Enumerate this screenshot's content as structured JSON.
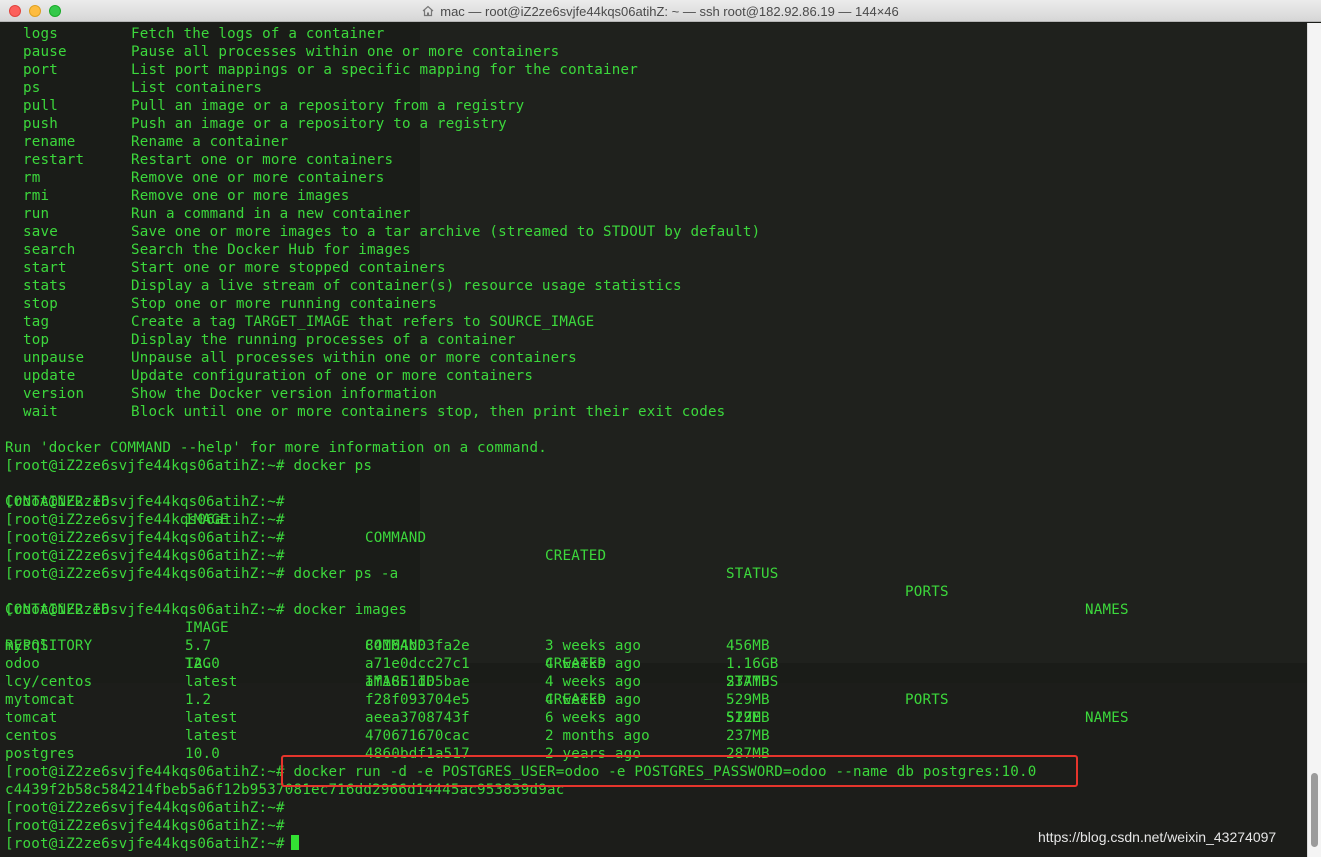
{
  "window": {
    "title": "mac — root@iZ2ze6svjfe44kqs06atihZ: ~ — ssh root@182.92.86.19 — 144×46"
  },
  "commands_help": [
    {
      "cmd": "logs",
      "desc": "Fetch the logs of a container"
    },
    {
      "cmd": "pause",
      "desc": "Pause all processes within one or more containers"
    },
    {
      "cmd": "port",
      "desc": "List port mappings or a specific mapping for the container"
    },
    {
      "cmd": "ps",
      "desc": "List containers"
    },
    {
      "cmd": "pull",
      "desc": "Pull an image or a repository from a registry"
    },
    {
      "cmd": "push",
      "desc": "Push an image or a repository to a registry"
    },
    {
      "cmd": "rename",
      "desc": "Rename a container"
    },
    {
      "cmd": "restart",
      "desc": "Restart one or more containers"
    },
    {
      "cmd": "rm",
      "desc": "Remove one or more containers"
    },
    {
      "cmd": "rmi",
      "desc": "Remove one or more images"
    },
    {
      "cmd": "run",
      "desc": "Run a command in a new container"
    },
    {
      "cmd": "save",
      "desc": "Save one or more images to a tar archive (streamed to STDOUT by default)"
    },
    {
      "cmd": "search",
      "desc": "Search the Docker Hub for images"
    },
    {
      "cmd": "start",
      "desc": "Start one or more stopped containers"
    },
    {
      "cmd": "stats",
      "desc": "Display a live stream of container(s) resource usage statistics"
    },
    {
      "cmd": "stop",
      "desc": "Stop one or more running containers"
    },
    {
      "cmd": "tag",
      "desc": "Create a tag TARGET_IMAGE that refers to SOURCE_IMAGE"
    },
    {
      "cmd": "top",
      "desc": "Display the running processes of a container"
    },
    {
      "cmd": "unpause",
      "desc": "Unpause all processes within one or more containers"
    },
    {
      "cmd": "update",
      "desc": "Update configuration of one or more containers"
    },
    {
      "cmd": "version",
      "desc": "Show the Docker version information"
    },
    {
      "cmd": "wait",
      "desc": "Block until one or more containers stop, then print their exit codes"
    }
  ],
  "help_footer": "Run 'docker COMMAND --help' for more information on a command.",
  "prompt": "[root@iZ2ze6svjfe44kqs06atihZ:~#",
  "cmd_ps": "docker ps",
  "cmd_ps_a": "docker ps -a",
  "cmd_images": "docker images",
  "cmd_run": "docker run -d -e POSTGRES_USER=odoo -e POSTGRES_PASSWORD=odoo --name db postgres:10.0",
  "container_headers": [
    "CONTAINER ID",
    "IMAGE",
    "COMMAND",
    "CREATED",
    "STATUS",
    "PORTS",
    "NAMES"
  ],
  "image_headers": [
    "REPOSITORY",
    "TAG",
    "IMAGE ID",
    "CREATED",
    "SIZE"
  ],
  "images": [
    [
      "mysql",
      "5.7",
      "84164b03fa2e",
      "3 weeks ago",
      "456MB"
    ],
    [
      "odoo",
      "12.0",
      "a71e0dcc27c1",
      "4 weeks ago",
      "1.16GB"
    ],
    [
      "lcy/centos",
      "latest",
      "af1851d05bae",
      "4 weeks ago",
      "237MB"
    ],
    [
      "mytomcat",
      "1.2",
      "f28f093704e5",
      "4 weeks ago",
      "529MB"
    ],
    [
      "tomcat",
      "latest",
      "aeea3708743f",
      "6 weeks ago",
      "529MB"
    ],
    [
      "centos",
      "latest",
      "470671670cac",
      "2 months ago",
      "237MB"
    ],
    [
      "postgres",
      "10.0",
      "4860bdf1a517",
      "2 years ago",
      "287MB"
    ]
  ],
  "container_hash": "c4439f2b58c584214fbeb5a6f12b9537081ec716dd2966d14445ac953839d9ac",
  "watermark": "https://blog.csdn.net/weixin_43274097",
  "colors": {
    "terminal_text": "#3cd83c",
    "background": "#1a1c18",
    "highlight": "#e5352c"
  }
}
